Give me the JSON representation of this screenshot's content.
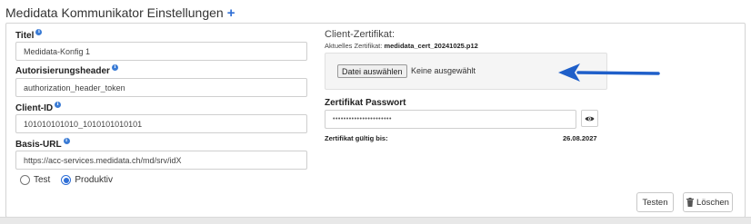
{
  "section": {
    "title": "Medidata Kommunikator Einstellungen",
    "add_symbol": "+"
  },
  "fields": {
    "title": {
      "label": "Titel",
      "value": "Medidata-Konfig 1"
    },
    "auth_header": {
      "label": "Autorisierungsheader",
      "value": "authorization_header_token"
    },
    "client_id": {
      "label": "Client-ID",
      "value": "101010101010_1010101010101"
    },
    "base_url": {
      "label": "Basis-URL",
      "value": "https://acc-services.medidata.ch/md/srv/idX"
    }
  },
  "environment": {
    "options": [
      "Test",
      "Produktiv"
    ],
    "selected": "Produktiv"
  },
  "certificate": {
    "title": "Client-Zertifikat:",
    "current_label": "Aktuelles Zertifikat:",
    "current_file": "medidata_cert_20241025.p12",
    "choose_button": "Datei auswählen",
    "no_file_text": "Keine ausgewählt",
    "password_label": "Zertifikat Passwort",
    "password_value": "••••••••••••••••••••••",
    "valid_until_label": "Zertifikat gültig bis:",
    "valid_until_value": "26.08.2027"
  },
  "actions": {
    "test_label": "Testen",
    "delete_label": "Löschen"
  },
  "icons": {
    "info": "info-icon",
    "eye": "eye-icon",
    "trash": "trash-icon",
    "arrow": "arrow-annotation"
  },
  "colors": {
    "accent": "#2f6fd6",
    "arrow": "#1f5fc9"
  }
}
